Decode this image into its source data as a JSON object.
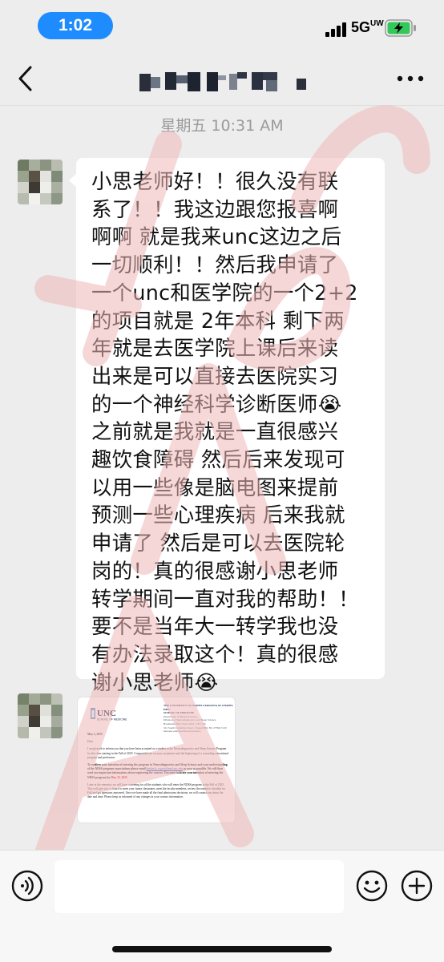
{
  "status_bar": {
    "time": "1:02",
    "network": "5G",
    "network_suffix": "UW"
  },
  "nav": {
    "back_icon": "chevron-left-icon",
    "title_blurred": true,
    "more_icon": "more-dots-icon"
  },
  "chat": {
    "timestamp": "星期五 10:31 AM",
    "messages": [
      {
        "type": "text",
        "text": "小思老师好！！很久没有联\n系了！！我这边跟您报喜啊\n啊啊 就是我来unc这边之后\n一切顺利！！然后我申请了\n一个unc和医学院的一个2+2\n的项目就是 2年本科 剩下两\n年就是去医学院上课后来读\n出来是可以直接去医院实习\n的一个神经科学诊断医师😭\n之前就是我就是一直很感兴\n趣饮食障碍 然后后来发现可\n以用一些像是脑电图来提前\n预测一些心理疾病 后来我就\n申请了 然后是可以去医院轮\n岗的！真的很感谢小思老师\n转学期间一直对我的帮助！！\n要不是当年大一转学我也没\n有办法录取这个！真的很感\n谢小思老师😭"
      },
      {
        "type": "image",
        "doc": {
          "logo": "UNC",
          "logo_sub": "SCHOOL OF MEDICINE",
          "header_lines": [
            "THE UNIVERSITY OF NORTH CAROLINA AT CHAPEL HILL",
            "SCHOOL OF MEDICINE",
            "Department of Health Sciences",
            "Division of Neurodiagnostics and Sleep Science",
            "",
            "Bondurant Hall | Suite 3024 | CB 7120",
            "321 South Columbia Street | Chapel Hill, NC 27599-7120",
            "med.unc.edu/healthsciences/neuro"
          ],
          "date": "May 2, 2025",
          "salutation": "Dear",
          "para1": "I am pleased to inform you that you have been accepted as a student in the Neurodiagnostics and Sleep Science Program for the class starting in the Fall of 2025. Congratulations on your acceptance and the beginning of a rewarding educational program and profession.",
          "para2_bold": "To confirm your intention of entering the program in Neurodiagnostics and Sleep Science and your understanding of the NDSS program expectations please email",
          "para2_email": "kimberly_rogers@med.unc.edu",
          "para2_bold_b": "as soon as possible. We will then send you important information about registering for courses. You must indicate your intention of entering the NDSS program by",
          "para2_date": "May 23, 2025",
          "para3": "Later in the semester, we will have a meeting for all the students who will enter the NDSS program in the Fall of 2025. This will give you a chance to meet your future classmates, meet the faculty members, review the tentative schedule for Fall and get questions answered. Once we have made all the final admissions decisions, we will contact you about the date and time. Please keep us informed of any changes in your contact information."
        }
      }
    ]
  },
  "input_bar": {
    "value": "",
    "placeholder": "",
    "voice_icon": "voice-icon",
    "emoji_icon": "emoji-icon",
    "plus_icon": "plus-icon"
  },
  "colors": {
    "time_pill": "#1E8BFF",
    "chat_bg": "#EDEDED",
    "bubble": "#FFFFFF",
    "watermark": "#F0B8B8"
  }
}
